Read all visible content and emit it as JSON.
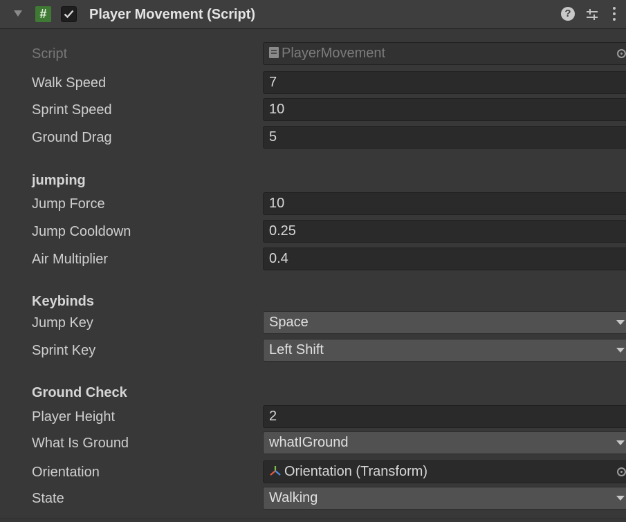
{
  "header": {
    "title": "Player Movement (Script)",
    "enabled": true,
    "icons": [
      "foldout-arrow-icon",
      "script-hash-icon",
      "enable-checkbox",
      "help-icon",
      "preset-icon",
      "kebab-menu-icon"
    ]
  },
  "fields": {
    "script": {
      "label": "Script",
      "value": "PlayerMovement"
    },
    "walk_speed": {
      "label": "Walk Speed",
      "value": "7"
    },
    "sprint_speed": {
      "label": "Sprint Speed",
      "value": "10"
    },
    "ground_drag": {
      "label": "Ground Drag",
      "value": "5"
    },
    "jump_force": {
      "label": "Jump Force",
      "value": "10"
    },
    "jump_cooldown": {
      "label": "Jump Cooldown",
      "value": "0.25"
    },
    "air_multiplier": {
      "label": "Air Multiplier",
      "value": "0.4"
    },
    "jump_key": {
      "label": "Jump Key",
      "value": "Space"
    },
    "sprint_key": {
      "label": "Sprint Key",
      "value": "Left Shift"
    },
    "player_height": {
      "label": "Player Height",
      "value": "2"
    },
    "what_is_ground": {
      "label": "What Is Ground",
      "value": "whatIGround"
    },
    "orientation": {
      "label": "Orientation",
      "value": "Orientation (Transform)"
    },
    "state": {
      "label": "State",
      "value": "Walking"
    }
  },
  "sections": {
    "jumping": "jumping",
    "keybinds": "Keybinds",
    "ground_check": "Ground Check"
  },
  "colors": {
    "background": "#383838",
    "header": "#3e3e3e",
    "script_icon": "#3f7a34",
    "field": "#2a2a2a",
    "dropdown": "#515151"
  }
}
